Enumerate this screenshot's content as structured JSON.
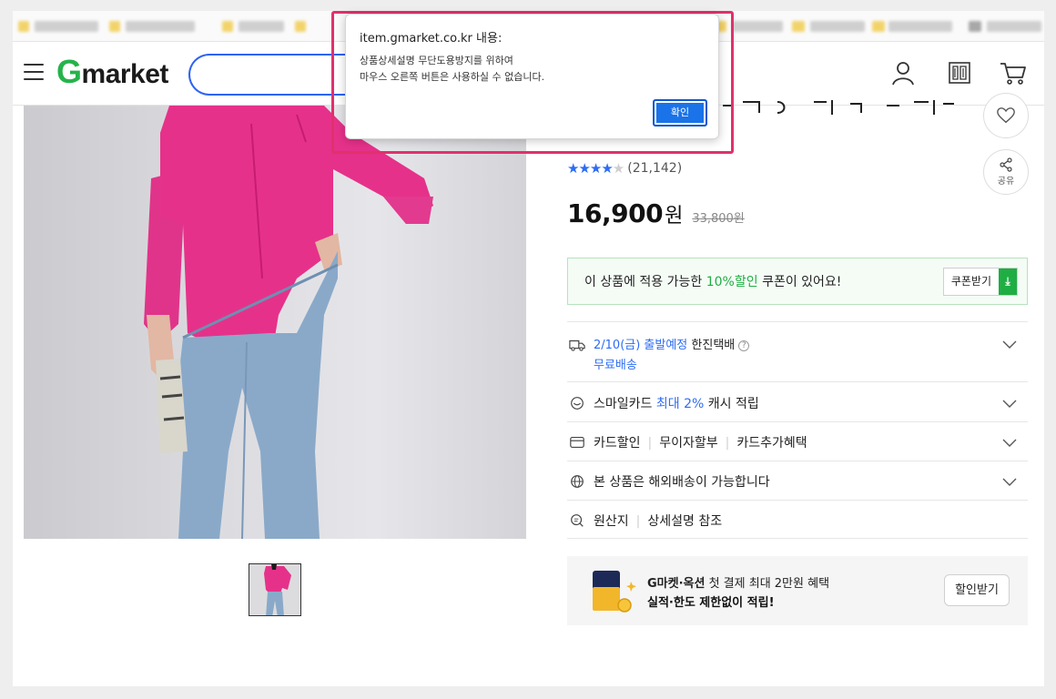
{
  "header": {
    "logo_g": "G",
    "logo_rest": "market",
    "brand_color": "#25b34a",
    "search_border_color": "#2c63f5",
    "icons": [
      "menu-icon",
      "user-icon",
      "recent-view-icon",
      "cart-icon"
    ]
  },
  "product": {
    "rating_stars": "★★★★",
    "rating_off_star": "★",
    "rating_value": 4,
    "rating_count": "(21,142)",
    "price": "16,900",
    "price_unit": "원",
    "original_price": "33,800원",
    "share_label": "공유",
    "wish_icon": "heart-icon",
    "share_icon": "share-icon"
  },
  "coupon": {
    "text_before": "이 상품에 적용 가능한 ",
    "highlight": "10%할인",
    "text_after": " 쿠폰이 있어요!",
    "button_label": "쿠폰받기",
    "accent_color": "#1fae43"
  },
  "info_rows": {
    "shipping": {
      "date": "2/10(금) 출발예정",
      "carrier": " 한진택배",
      "help": "?",
      "free": "무료배송"
    },
    "smilecard": {
      "before": "스마일카드 ",
      "highlight": "최대 2%",
      "after": " 캐시 적립"
    },
    "card": {
      "item1": "카드할인",
      "item2": "무이자할부",
      "item3": "카드추가혜택"
    },
    "overseas": {
      "text": "본 상품은 해외배송이 가능합니다"
    },
    "origin": {
      "item1": "원산지",
      "item2": "상세설명 참조"
    }
  },
  "promo": {
    "line1_bold": "G마켓·옥션",
    "line1_rest": " 첫 결제 최대 2만원 혜택",
    "line2": "실적·한도 제한없이 적립!",
    "button_label": "할인받기"
  },
  "alert": {
    "title": "item.gmarket.co.kr 내용:",
    "message_line1": "상품상세설명 무단도용방지를 위하여",
    "message_line2": "마우스 오른쪽 버튼은 사용하실 수 없습니다.",
    "ok_label": "확인",
    "highlight_color": "#e0316c",
    "button_color": "#1a73e8"
  }
}
